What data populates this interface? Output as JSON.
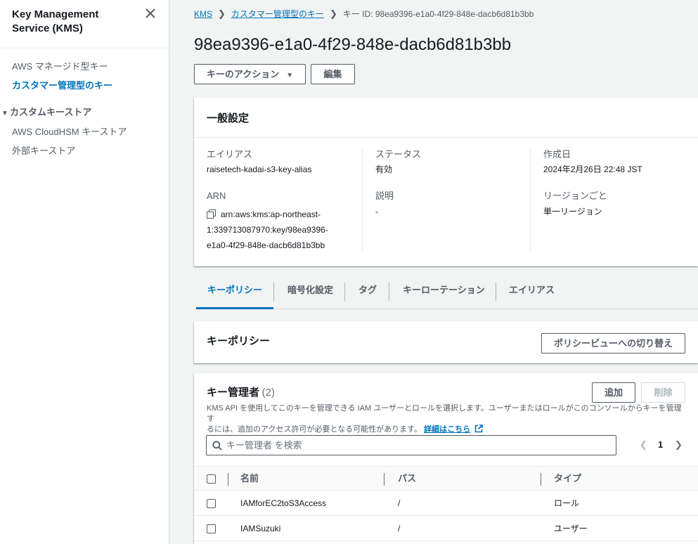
{
  "sidebar": {
    "title": "Key Management Service (KMS)",
    "close_icon": "close-icon",
    "items": [
      {
        "label": "AWS マネージド型キー"
      },
      {
        "label": "カスタマー管理型のキー"
      }
    ],
    "section": {
      "label": "カスタムキーストア",
      "items": [
        {
          "label": "AWS CloudHSM キーストア"
        },
        {
          "label": "外部キーストア"
        }
      ]
    }
  },
  "breadcrumb": {
    "items": [
      "KMS",
      "カスタマー管理型のキー"
    ],
    "current": "キー ID: 98ea9396-e1a0-4f29-848e-dacb6d81b3bb"
  },
  "page": {
    "title": "98ea9396-e1a0-4f29-848e-dacb6d81b3bb",
    "actions_label": "キーのアクション",
    "edit_label": "編集"
  },
  "general": {
    "heading": "一般設定",
    "alias_label": "エイリアス",
    "alias_value": "raisetech-kadai-s3-key-alias",
    "arn_label": "ARN",
    "arn_line1": "arn:aws:kms:ap-northeast-",
    "arn_line2": "1:339713087970:key/98ea9396-",
    "arn_line3": "e1a0-4f29-848e-dacb6d81b3bb",
    "status_label": "ステータス",
    "status_value": "有効",
    "description_label": "説明",
    "description_value": "-",
    "created_label": "作成日",
    "created_value": "2024年2月26日 22:48 JST",
    "region_label": "リージョンごと",
    "region_value": "単一リージョン"
  },
  "tabs": [
    {
      "label": "キーポリシー"
    },
    {
      "label": "暗号化設定"
    },
    {
      "label": "タグ"
    },
    {
      "label": "キーローテーション"
    },
    {
      "label": "エイリアス"
    }
  ],
  "policy": {
    "heading": "キーポリシー",
    "switch_label": "ポリシービューへの切り替え"
  },
  "admins": {
    "heading": "キー管理者",
    "count": "(2)",
    "add_label": "追加",
    "remove_label": "削除",
    "desc_line1": "KMS API を使用してこのキーを管理できる IAM ユーザーとロールを選択します。ユーザーまたはロールがこのコンソールからキーを管理す",
    "desc_line2": "るには、追加のアクセス許可が必要となる可能性があります。",
    "learn_more": "詳細はこちら",
    "search_placeholder": "キー管理者 を検索",
    "page_number": "1",
    "columns": [
      "名前",
      "パス",
      "タイプ"
    ],
    "rows": [
      {
        "name": "IAMforEC2toS3Access",
        "path": "/",
        "type": "ロール"
      },
      {
        "name": "IAMSuzuki",
        "path": "/",
        "type": "ユーザー"
      }
    ]
  }
}
